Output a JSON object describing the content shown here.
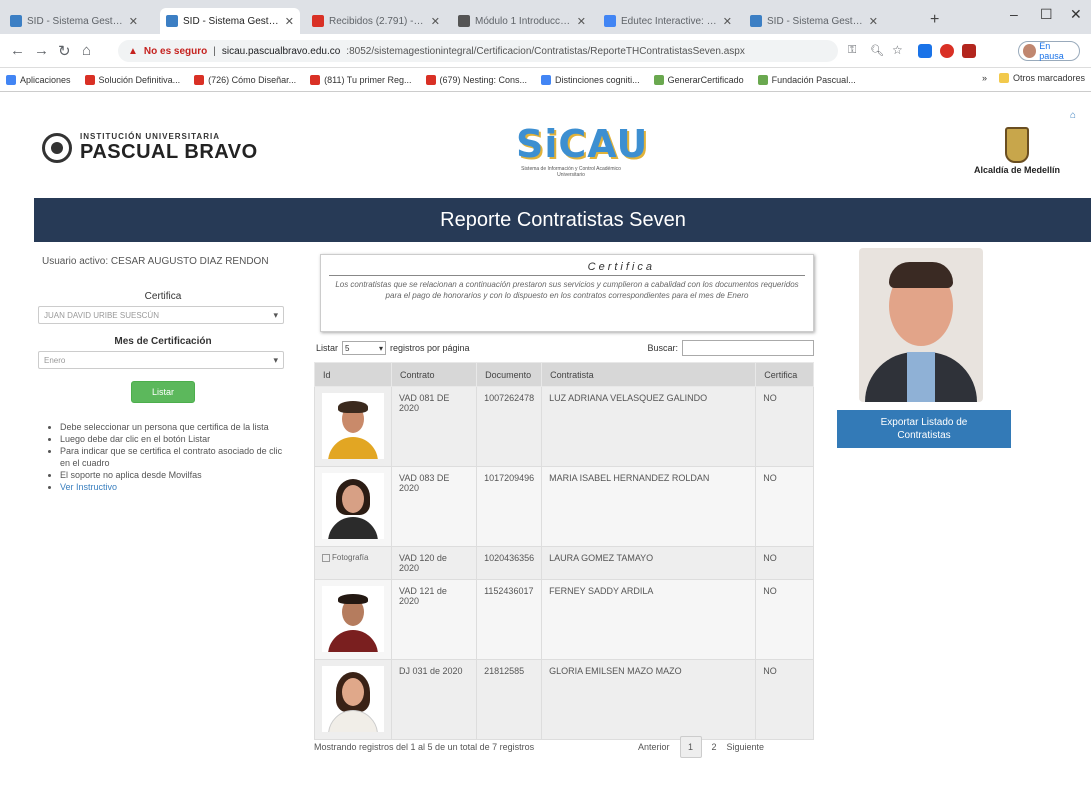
{
  "browser": {
    "tabs": [
      {
        "title": "SID - Sistema Gestión Ins",
        "color": "#3c7fc4"
      },
      {
        "title": "SID - Sistema Gestión Ins",
        "color": "#3c7fc4"
      },
      {
        "title": "Recibidos (2.791) - david",
        "color": "#d93025"
      },
      {
        "title": "Módulo 1 Introducción",
        "color": "#555555"
      },
      {
        "title": "Edutec Interactive: 1.1.2",
        "color": "#4285f4"
      },
      {
        "title": "SID - Sistema Gestión Ins",
        "color": "#3c7fc4"
      }
    ],
    "url_warning": "No es seguro",
    "url_host": "sicau.pascualbravo.edu.co",
    "url_path": ":8052/sistemagestionintegral/Certificacion/Contratistas/ReporteTHContratistasSeven.aspx",
    "profile_label": "En pausa",
    "bookmarks": [
      {
        "label": "Aplicaciones",
        "color": "#4285f4"
      },
      {
        "label": "Solución Definitiva...",
        "color": "#d93025"
      },
      {
        "label": "(726) Cómo Diseñar...",
        "color": "#d93025"
      },
      {
        "label": "(811) Tu primer Reg...",
        "color": "#d93025"
      },
      {
        "label": "(679) Nesting: Cons...",
        "color": "#d93025"
      },
      {
        "label": "Distinciones cogniti...",
        "color": "#4285f4"
      },
      {
        "label": "GenerarCertificado",
        "color": "#6aa84f"
      },
      {
        "label": "Fundación Pascual...",
        "color": "#6aa84f"
      }
    ],
    "bookmarks_more": "»",
    "other_bookmarks": "Otros marcadores"
  },
  "logos": {
    "pb_line1": "INSTITUCIÓN UNIVERSITARIA",
    "pb_line2": "PASCUAL BRAVO",
    "sicau": "SiCAU",
    "sicau_sub": "Sistema de Información y Control Académico Universitario",
    "alcaldia": "Alcaldía de Medellín"
  },
  "banner": "Reporte Contratistas Seven",
  "left": {
    "user_label": "Usuario activo:",
    "user_name": "CESAR AUGUSTO DIAZ RENDON",
    "certifica_label": "Certifica",
    "certifica_value": "JUAN DAVID URIBE SUESCÚN",
    "mes_label": "Mes de Certificación",
    "mes_value": "Enero",
    "listar": "Listar",
    "notes": [
      "Debe seleccionar un persona que certifica de la lista",
      "Luego debe dar clic en el botón Listar",
      "Para indicar que se certifica el contrato asociado de clic en el cuadro",
      "El soporte no aplica desde Movilfas"
    ],
    "instructivo": "Ver Instructivo"
  },
  "certifica": {
    "title": "Certifica",
    "text": "Los contratistas que se relacionan a continuación prestaron sus servicios y cumplieron a cabalidad con los documentos requeridos para el pago de honorarios y con lo dispuesto en los contratos correspondientes para el mes de Enero"
  },
  "table_controls": {
    "listar_label": "Listar",
    "page_size": "5",
    "per_page": "registros por página",
    "buscar": "Buscar:"
  },
  "table": {
    "headers": [
      "Id",
      "Contrato",
      "Documento",
      "Contratista",
      "Certifica"
    ],
    "rows": [
      {
        "contrato": "VAD 081 DE 2020",
        "documento": "1007262478",
        "contratista": "LUZ ADRIANA VELASQUEZ GALINDO",
        "certifica": "NO",
        "photo": "woman-1"
      },
      {
        "contrato": "VAD 083 DE 2020",
        "documento": "1017209496",
        "contratista": "MARIA ISABEL HERNANDEZ ROLDAN",
        "certifica": "NO",
        "photo": "woman-2"
      },
      {
        "contrato": "VAD 120 de 2020",
        "documento": "1020436356",
        "contratista": "LAURA GOMEZ TAMAYO",
        "certifica": "NO",
        "photo": "none",
        "no_photo_label": "Fotografía"
      },
      {
        "contrato": "VAD 121 de 2020",
        "documento": "1152436017",
        "contratista": "FERNEY SADDY ARDILA",
        "certifica": "NO",
        "photo": "man-1"
      },
      {
        "contrato": "DJ 031 de 2020",
        "documento": "21812585",
        "contratista": "GLORIA EMILSEN MAZO MAZO",
        "certifica": "NO",
        "photo": "woman-3"
      }
    ]
  },
  "footer_info": "Mostrando registros del 1 al 5 de un total de 7 registros",
  "pager": {
    "prev": "Anterior",
    "pages": [
      "1",
      "2"
    ],
    "next": "Siguiente"
  },
  "export_button": "Exportar Listado de Contratistas",
  "colors": {
    "banner": "#273a56",
    "listar": "#5cb85c",
    "export": "#337ab7"
  }
}
